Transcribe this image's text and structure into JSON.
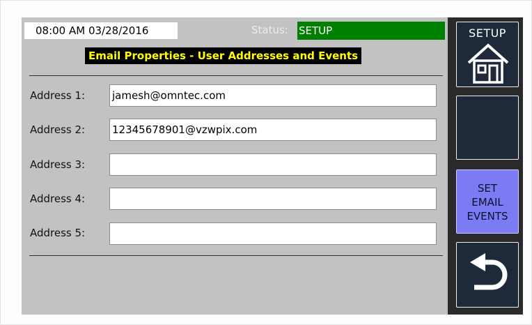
{
  "header": {
    "datetime": "08:00 AM 03/28/2016",
    "status_label": "Status:",
    "status_value": "SETUP",
    "status_color": "#008000"
  },
  "title": "Email Properties - User Addresses and Events",
  "addresses": [
    {
      "label": "Address 1:",
      "value": "jamesh@omntec.com"
    },
    {
      "label": "Address 2:",
      "value": "12345678901@vzwpix.com"
    },
    {
      "label": "Address 3:",
      "value": ""
    },
    {
      "label": "Address 4:",
      "value": ""
    },
    {
      "label": "Address 5:",
      "value": ""
    }
  ],
  "sidebar": {
    "setup_label": "SETUP",
    "setup_icon": "house-icon",
    "email_events_lines": [
      "SET",
      "EMAIL",
      "EVENTS"
    ],
    "email_events_color": "#7b7cf4",
    "back_icon": "back-arrow-icon"
  }
}
